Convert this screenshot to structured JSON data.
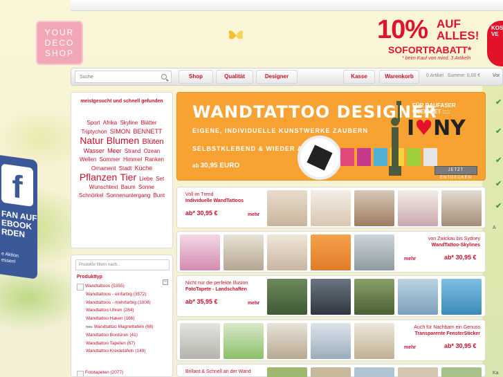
{
  "logo": {
    "line1": "YOUR",
    "line2": "DECO",
    "line3": "SHOP"
  },
  "promo": {
    "percent": "10%",
    "auf": "AUF",
    "alles": "ALLES!",
    "sofortrabatt": "SOFORTRABATT",
    "note": "* beim Kauf von mind. 3 Artikeln",
    "badge_line1": "KOS",
    "badge_line2": "VE"
  },
  "nav": {
    "search_placeholder": "Suche",
    "shop": "Shop",
    "qualitaet": "Qualität",
    "designer": "Designer",
    "kasse": "Kasse",
    "warenkorb": "Warenkorb",
    "artikel": "0 Artikel",
    "summe": "Summe: 0,00 €",
    "vor": "Vor"
  },
  "sidebar": {
    "cloud_title": "meistgesucht und schnell gefunden",
    "tags": [
      {
        "t": "Sport",
        "s": 8
      },
      {
        "t": "Afrika",
        "s": 8
      },
      {
        "t": "Skyline",
        "s": 8
      },
      {
        "t": "Blätter",
        "s": 8
      },
      {
        "t": "Triptychon",
        "s": 8
      },
      {
        "t": "SIMON",
        "s": 9
      },
      {
        "t": "BENNETT",
        "s": 9
      },
      {
        "t": "Natur",
        "s": 14
      },
      {
        "t": "Blumen",
        "s": 14
      },
      {
        "t": "Blüten",
        "s": 11
      },
      {
        "t": "Wasser",
        "s": 9
      },
      {
        "t": "Meer",
        "s": 9
      },
      {
        "t": "Strand",
        "s": 8
      },
      {
        "t": "Ozean",
        "s": 8
      },
      {
        "t": "Wellen",
        "s": 8
      },
      {
        "t": "Sommer",
        "s": 8
      },
      {
        "t": "Himmel",
        "s": 8
      },
      {
        "t": "Ranken",
        "s": 8
      },
      {
        "t": "Ornament",
        "s": 8
      },
      {
        "t": "Stadt",
        "s": 8
      },
      {
        "t": "Küche",
        "s": 9
      },
      {
        "t": "Pflanzen",
        "s": 14
      },
      {
        "t": "Tier",
        "s": 14
      },
      {
        "t": "Liebe",
        "s": 8
      },
      {
        "t": "Set",
        "s": 8
      },
      {
        "t": "Wunschtext",
        "s": 8
      },
      {
        "t": "Baum",
        "s": 8
      },
      {
        "t": "Sonne",
        "s": 8
      },
      {
        "t": "Schnörkel",
        "s": 8
      },
      {
        "t": "Sonnenuntergang",
        "s": 8
      },
      {
        "t": "Bunt",
        "s": 8
      }
    ],
    "filter_placeholder": "Produkte filtern nach...",
    "filter_heading": "Produkttyp",
    "filter_items": [
      {
        "label": "Wandtattoos (5355)",
        "top": true
      },
      {
        "label": "Wandtattoos - einfarbig (3572)"
      },
      {
        "label": "Wandtattoos - mehrfarbig (1008)"
      },
      {
        "label": "Wandtattoo Uhren (284)"
      },
      {
        "label": "Wandtattoo Haken (166)"
      },
      {
        "label": "Wandtattoo Magnettafeln (68)",
        "neu": "neu"
      },
      {
        "label": "Wandtattoo Bordüren (41)"
      },
      {
        "label": "Wandtattoo Tapeten (67)"
      },
      {
        "label": "Wandtattoo Kreidetafeln (149)"
      }
    ],
    "filter_bottom": "Fototapeten (2077)"
  },
  "facebook": {
    "logo": "f",
    "text1": "FAN AUF",
    "text2": "EBOOK",
    "text3": "RDEN",
    "small1": "e Aktion",
    "small2": "essen!"
  },
  "banner": {
    "title": "WANDTATTOO DESIGNER",
    "sub1": "EIGENE, INDIVIDUELLE KUNSTWERKE ZAUBERN",
    "sub2": "SELBSTKLEBEND & WIEDER ABLÖSBAR",
    "price_prefix": "ab",
    "price": "30,95 EURO",
    "raufaser": "FÜR RAUFASER GEEIGNET",
    "ny_i": "I",
    "ny_heart": "♥",
    "ny": "NY",
    "cta": "JETZT ENTDECKEN"
  },
  "rows": [
    {
      "small": "Voll im Trend",
      "title": "Individuelle WandTattoos",
      "price": "ab* 30,95 €",
      "more": "mehr"
    },
    {
      "small": "von Zwickau bis Sydney",
      "title": "WandTattoo-Skylines",
      "price": "ab* 30,95 €",
      "more": "mehr"
    },
    {
      "small": "Nicht nur die perfekte Illusion",
      "title": "FotoTapete - Landschaften",
      "price": "ab* 35,95 €",
      "more": "mehr"
    },
    {
      "small": "Auch für Nachbarn ein Genuss",
      "title": "Transparente FensterSticker",
      "price": "ab* 30,95 €",
      "more": "mehr"
    },
    {
      "small": "Brillant & Schnell an der Wand",
      "title": "",
      "price": "",
      "more": ""
    }
  ],
  "right": {
    "label_a": "A",
    "label_ka": "Ka"
  }
}
